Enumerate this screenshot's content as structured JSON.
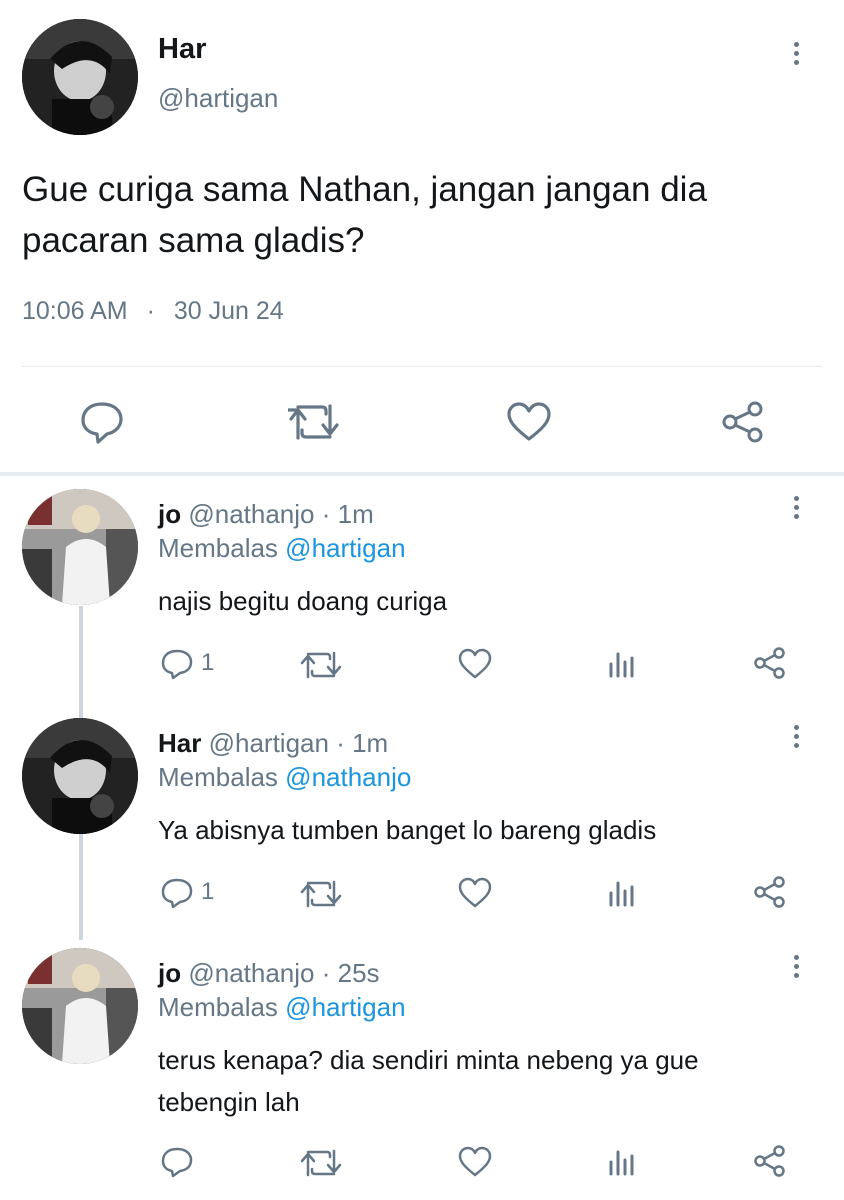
{
  "main_tweet": {
    "name": "Har",
    "handle": "@hartigan",
    "text": "Gue curiga sama Nathan, jangan jangan dia pacaran sama gladis?",
    "time": "10:06 AM",
    "separator": "·",
    "date": "30 Jun 24",
    "actions": [
      "reply-icon",
      "retweet-icon",
      "like-icon",
      "share-icon"
    ]
  },
  "replies": [
    {
      "name": "jo",
      "handle": "@nathanjo",
      "dot": "·",
      "age": "1m",
      "replying_prefix": "Membalas",
      "replying_to": "@hartigan",
      "text": "najis begitu doang curiga",
      "reply_count": "1"
    },
    {
      "name": "Har",
      "handle": "@hartigan",
      "dot": "·",
      "age": "1m",
      "replying_prefix": "Membalas",
      "replying_to": "@nathanjo",
      "text": "Ya abisnya tumben banget lo bareng gladis",
      "reply_count": "1"
    },
    {
      "name": "jo",
      "handle": "@nathanjo",
      "dot": "·",
      "age": "25s",
      "replying_prefix": "Membalas",
      "replying_to": "@hartigan",
      "text_line1": "terus kenapa? dia sendiri minta nebeng ya gue",
      "text_line2": "tebengin lah",
      "reply_count": ""
    }
  ],
  "colors": {
    "text": "#14171a",
    "secondary": "#657786",
    "link": "#1b95e0",
    "divider": "#e6ecf0"
  }
}
